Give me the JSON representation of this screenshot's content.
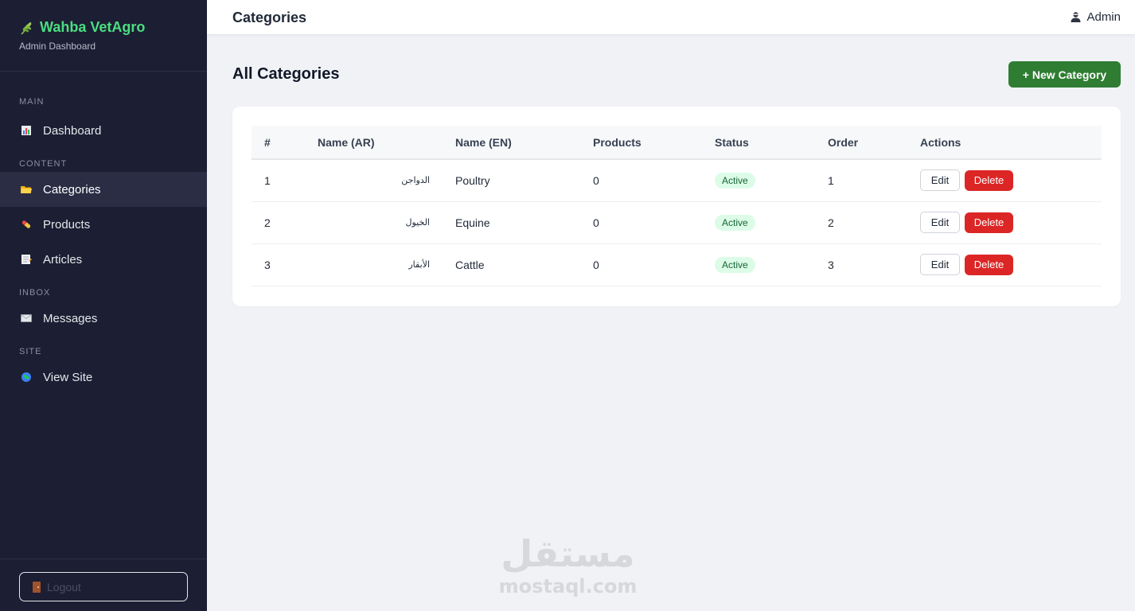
{
  "sidebar": {
    "brand_title": "Wahba VetAgro",
    "brand_subtitle": "Admin Dashboard",
    "sections": {
      "main": "MAIN",
      "content": "CONTENT",
      "inbox": "INBOX",
      "site": "SITE"
    },
    "items": {
      "dashboard": "Dashboard",
      "categories": "Categories",
      "products": "Products",
      "articles": "Articles",
      "messages": "Messages",
      "view_site": "View Site"
    },
    "logout_label": "Logout"
  },
  "topbar": {
    "title": "Categories",
    "user": "Admin"
  },
  "main": {
    "heading": "All Categories",
    "new_button": "+ New Category",
    "table": {
      "headers": [
        "#",
        "Name (AR)",
        "Name (EN)",
        "Products",
        "Status",
        "Order",
        "Actions"
      ],
      "rows": [
        {
          "id": "1",
          "name_ar": "الدواجن",
          "name_en": "Poultry",
          "products": "0",
          "status": "Active",
          "order": "1",
          "edit": "Edit",
          "delete": "Delete"
        },
        {
          "id": "2",
          "name_ar": "الخيول",
          "name_en": "Equine",
          "products": "0",
          "status": "Active",
          "order": "2",
          "edit": "Edit",
          "delete": "Delete"
        },
        {
          "id": "3",
          "name_ar": "الأبقار",
          "name_en": "Cattle",
          "products": "0",
          "status": "Active",
          "order": "3",
          "edit": "Edit",
          "delete": "Delete"
        }
      ]
    }
  },
  "watermark": {
    "arabic": "مستقل",
    "latin": "mostaql.com"
  },
  "colors": {
    "sidebar_bg": "#1c1e33",
    "brand_green": "#4ade80",
    "primary_button": "#2e7d32",
    "delete_button": "#dc2626",
    "status_active_bg": "#dcfce7",
    "status_active_text": "#166534"
  }
}
